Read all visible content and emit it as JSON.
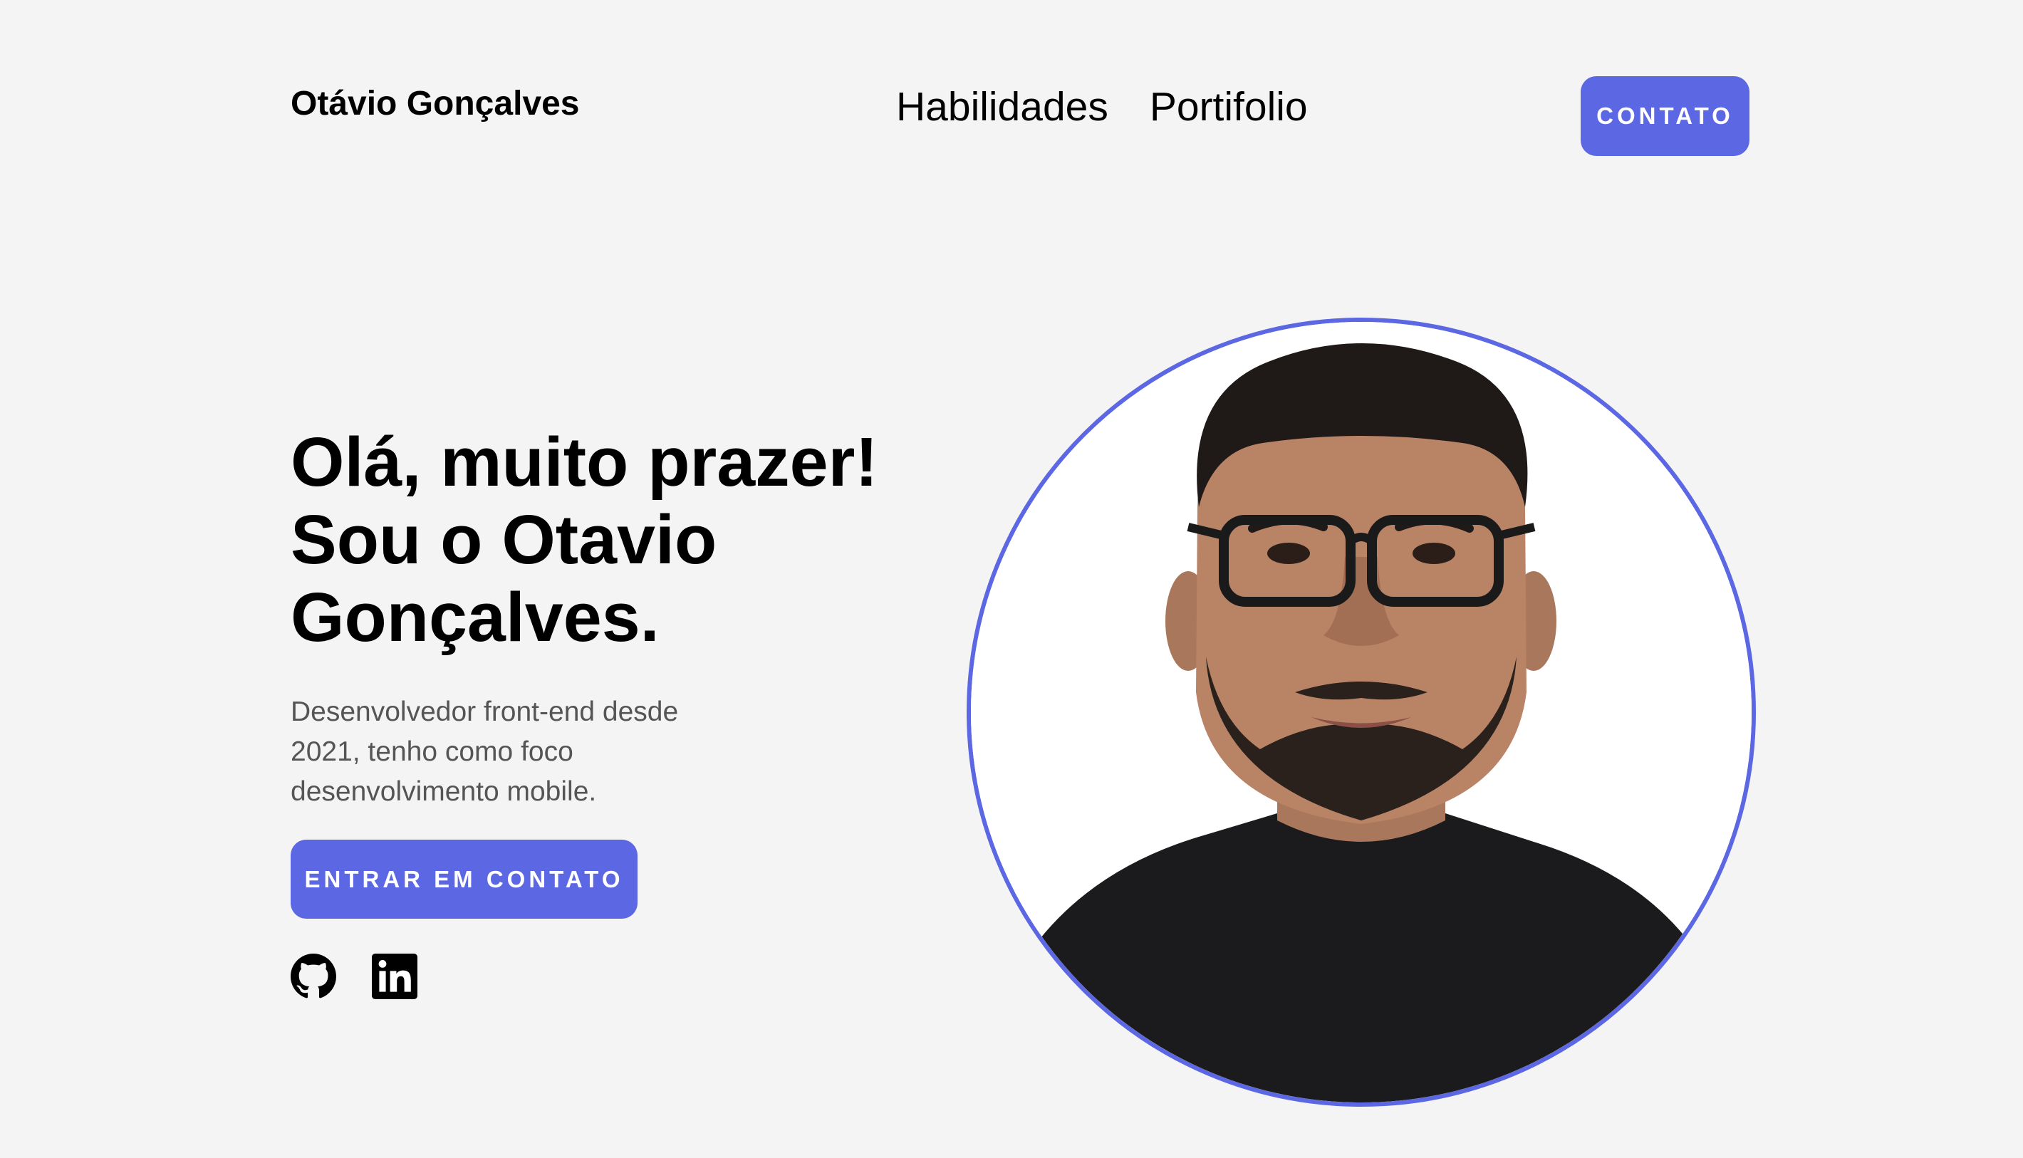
{
  "header": {
    "logo": "Otávio Gonçalves",
    "nav": [
      {
        "label": "Habilidades"
      },
      {
        "label": "Portifolio"
      }
    ],
    "contact_button": "CONTATO"
  },
  "hero": {
    "title_lines": [
      "Olá, muito prazer!",
      "Sou o Otavio",
      "Gonçalves."
    ],
    "description": "Desenvolvedor front-end desde 2021, tenho como foco desenvolvimento mobile.",
    "cta_button": "ENTRAR EM CONTATO",
    "social": [
      {
        "icon": "github-icon"
      },
      {
        "icon": "linkedin-icon"
      }
    ]
  },
  "colors": {
    "background": "#f4f4f4",
    "accent": "#5c67e3",
    "text": "#000000",
    "muted_text": "#555555"
  }
}
